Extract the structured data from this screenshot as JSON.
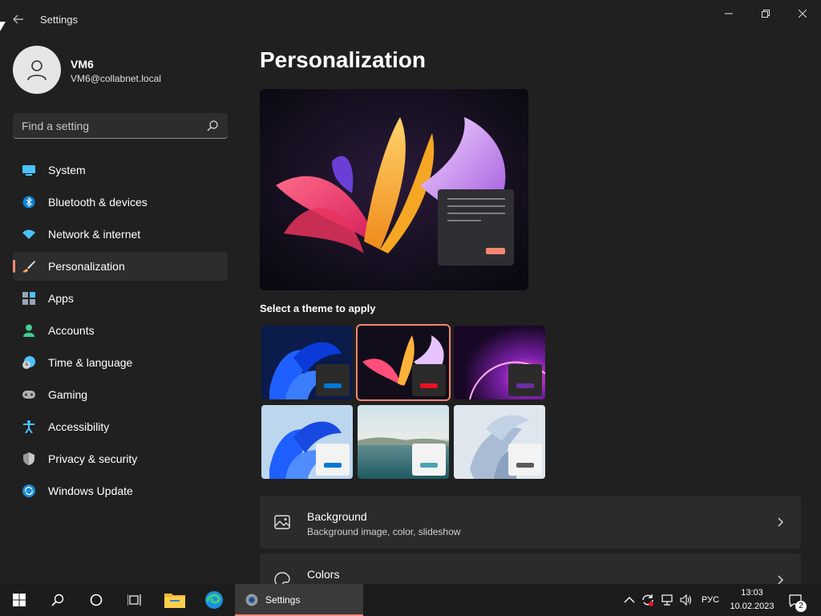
{
  "window": {
    "title": "Settings"
  },
  "profile": {
    "name": "VM6",
    "email": "VM6@collabnet.local"
  },
  "search": {
    "placeholder": "Find a setting"
  },
  "sidebar": {
    "items": [
      {
        "label": "System",
        "icon": "monitor-icon"
      },
      {
        "label": "Bluetooth & devices",
        "icon": "bluetooth-icon"
      },
      {
        "label": "Network & internet",
        "icon": "wifi-icon"
      },
      {
        "label": "Personalization",
        "icon": "brush-icon",
        "active": true
      },
      {
        "label": "Apps",
        "icon": "apps-icon"
      },
      {
        "label": "Accounts",
        "icon": "person-icon"
      },
      {
        "label": "Time & language",
        "icon": "clock-globe-icon"
      },
      {
        "label": "Gaming",
        "icon": "gamepad-icon"
      },
      {
        "label": "Accessibility",
        "icon": "accessibility-icon"
      },
      {
        "label": "Privacy & security",
        "icon": "shield-icon"
      },
      {
        "label": "Windows Update",
        "icon": "update-icon"
      }
    ]
  },
  "main": {
    "title": "Personalization",
    "theme_section_label": "Select a theme to apply",
    "themes": [
      {
        "name": "windows-dark-blue",
        "swatch": "#0078d4",
        "selected": false
      },
      {
        "name": "glow-dark",
        "swatch": "#e81123",
        "selected": true
      },
      {
        "name": "captured-motion",
        "swatch": "#6b2fa0",
        "selected": false
      },
      {
        "name": "windows-light",
        "swatch": "#0078d4",
        "selected": false
      },
      {
        "name": "sunrise-lake",
        "swatch": "#4aa3b5",
        "selected": false
      },
      {
        "name": "flow",
        "swatch": "#5a5a5a",
        "selected": false
      }
    ],
    "settings": [
      {
        "title": "Background",
        "subtitle": "Background image, color, slideshow",
        "icon": "picture-icon"
      },
      {
        "title": "Colors",
        "subtitle": "",
        "icon": "palette-icon"
      }
    ]
  },
  "taskbar": {
    "active_app": "Settings",
    "language": "РУС",
    "time": "13:03",
    "date": "10.02.2023",
    "notifications": "2"
  },
  "colors": {
    "accent": "#f48771",
    "background": "#202020",
    "card": "#2b2b2b"
  }
}
